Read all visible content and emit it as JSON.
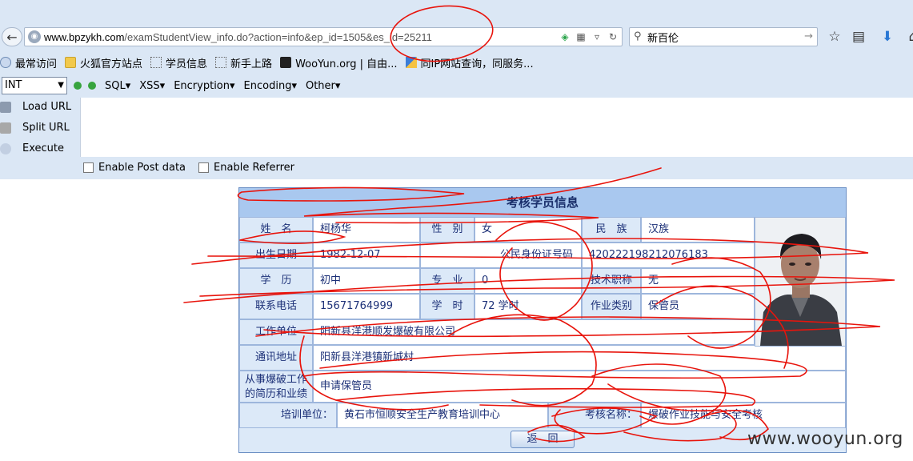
{
  "browser": {
    "url_host": "www.bpzykh.com",
    "url_path": "/examStudentView_info.do?action=info&ep_id=1505&es_id=25211",
    "search_value": "新百伦"
  },
  "bookmarks": {
    "items": [
      "最常访问",
      "火狐官方站点",
      "学员信息",
      "新手上路",
      "WooYun.org | 自由...",
      "同IP网站查询，同服务..."
    ]
  },
  "hackbar": {
    "select_value": "INT",
    "menus": [
      "SQL▾",
      "XSS▾",
      "Encryption▾",
      "Encoding▾",
      "Other▾"
    ],
    "load_url": "Load URL",
    "split_url": "Split URL",
    "execute": "Execute",
    "enable_post": "Enable Post data",
    "enable_referrer": "Enable Referrer"
  },
  "student": {
    "title": "考核学员信息",
    "name_label": "姓　名",
    "name_value": "柯杨华",
    "gender_label": "性　别",
    "gender_value": "女",
    "ethnic_label": "民　族",
    "ethnic_value": "汉族",
    "birth_label": "出生日期",
    "birth_value": "1982-12-07",
    "id_label": "公民身份证号码",
    "id_value": "420222198212076183",
    "edu_label": "学　历",
    "edu_value": "初中",
    "major_label": "专　业",
    "major_value": "0",
    "title_label": "技术职称",
    "title_value": "无",
    "phone_label": "联系电话",
    "phone_value": "15671764999",
    "hours_label": "学　时",
    "hours_value": "72 学时",
    "jobtype_label": "作业类别",
    "jobtype_value": "保管员",
    "work_label": "工作单位",
    "work_value": "阳新县洋港顺发爆破有限公司",
    "addr_label": "通讯地址",
    "addr_value": "阳新县洋港镇新城村",
    "history_label": "从事爆破工作的简历和业绩",
    "history_value": "申请保管员",
    "train_label": "培训单位：",
    "train_value": "黄石市恒顺安全生产教育培训中心",
    "exam_label": "考核名称：",
    "exam_value": "爆破作业技能与安全考核",
    "return_label": "返　回"
  },
  "watermark": "www.wooyun.org"
}
